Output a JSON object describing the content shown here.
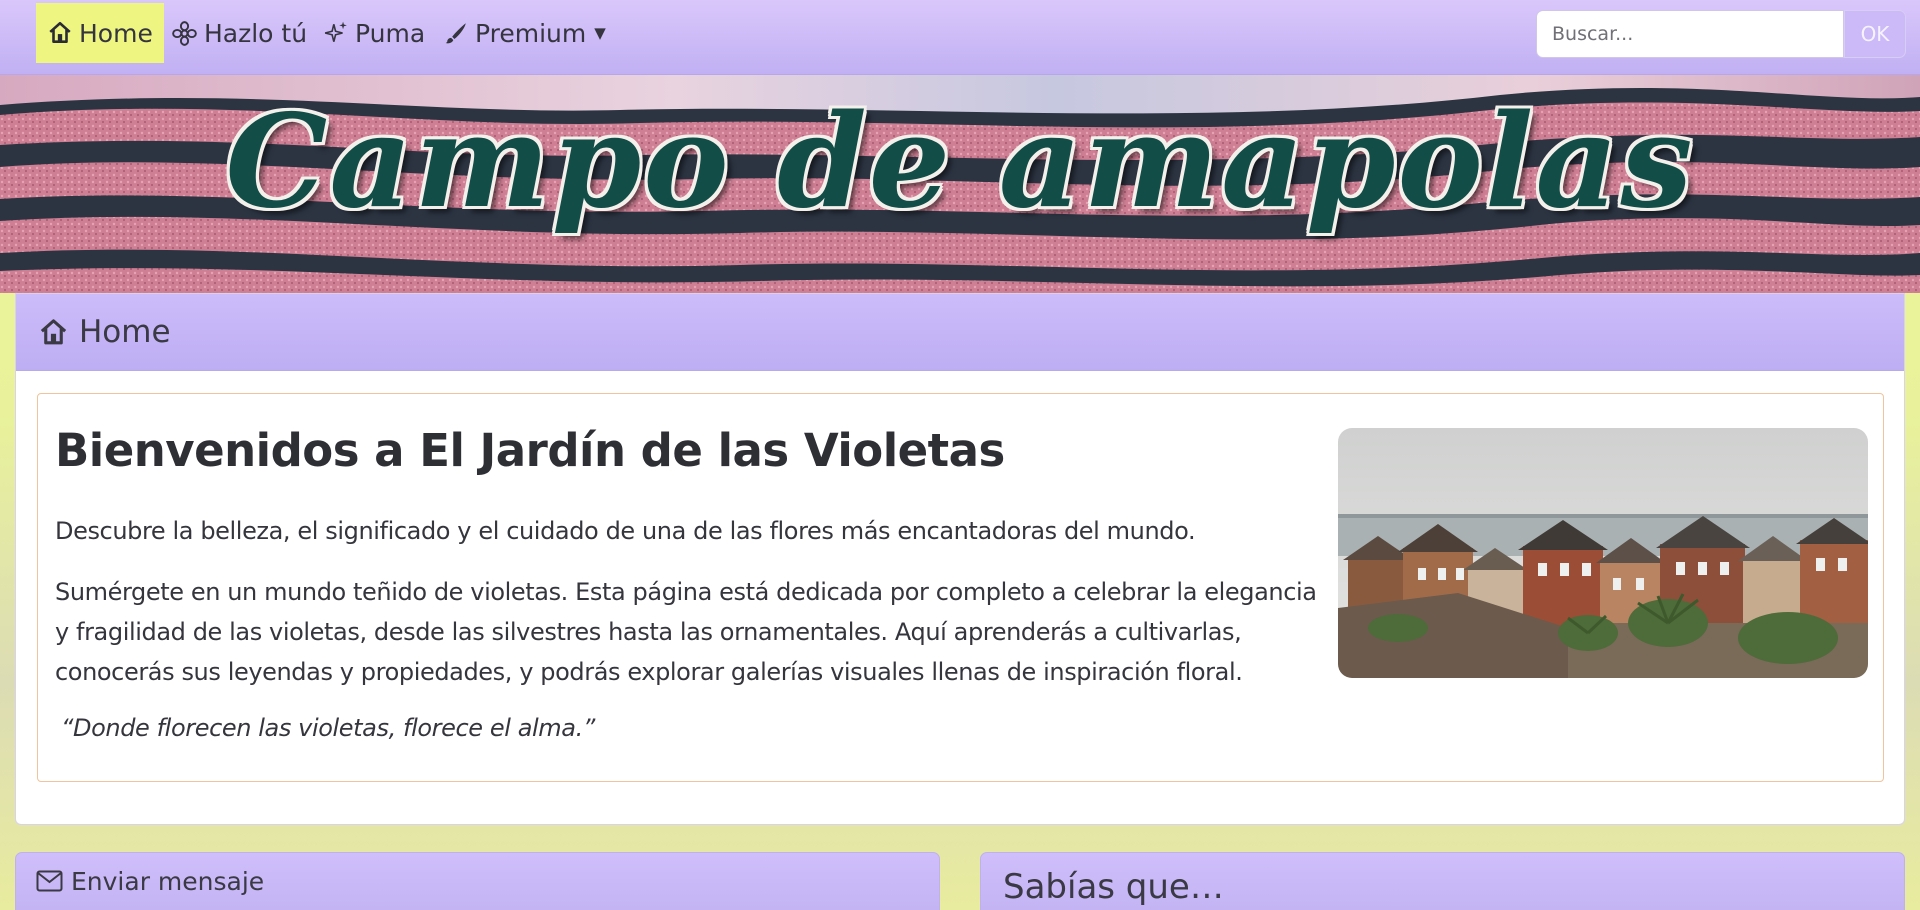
{
  "nav": {
    "items": [
      {
        "label": "Home",
        "icon": "home-icon",
        "active": true
      },
      {
        "label": "Hazlo tú",
        "icon": "flower-icon"
      },
      {
        "label": "Puma",
        "icon": "sparkles-icon"
      },
      {
        "label": "Premium",
        "icon": "brush-icon",
        "dropdown": true
      }
    ],
    "search": {
      "placeholder": "Buscar..."
    },
    "ok_label": "OK"
  },
  "banner": {
    "title": "Campo de amapolas"
  },
  "main": {
    "header": "Home",
    "title": "Bienvenidos a El Jardín de las Violetas",
    "lead": "Descubre la belleza, el significado y el cuidado de una de las flores más encantadoras del mundo.",
    "body": "Sumérgete en un mundo teñido de violetas. Esta página está dedicada por completo a celebrar la elegancia y fragilidad de las violetas, desde las silvestres hasta las ornamentales. Aquí aprenderás a cultivarlas, conocerás sus leyendas y propiedades, y podrás explorar galerías visuales llenas de inspiración floral.",
    "quote": "“Donde florecen las violetas, florece el alma.”"
  },
  "lower": {
    "message_title": "Enviar mensaje",
    "did_you_know_title": "Sabías que…"
  },
  "colors": {
    "nav_bg": "#c9b8f8",
    "active_bg": "#eef681",
    "title_green": "#134d48",
    "page_bg": "#e9f29a",
    "inner_border": "#f1c49b"
  }
}
